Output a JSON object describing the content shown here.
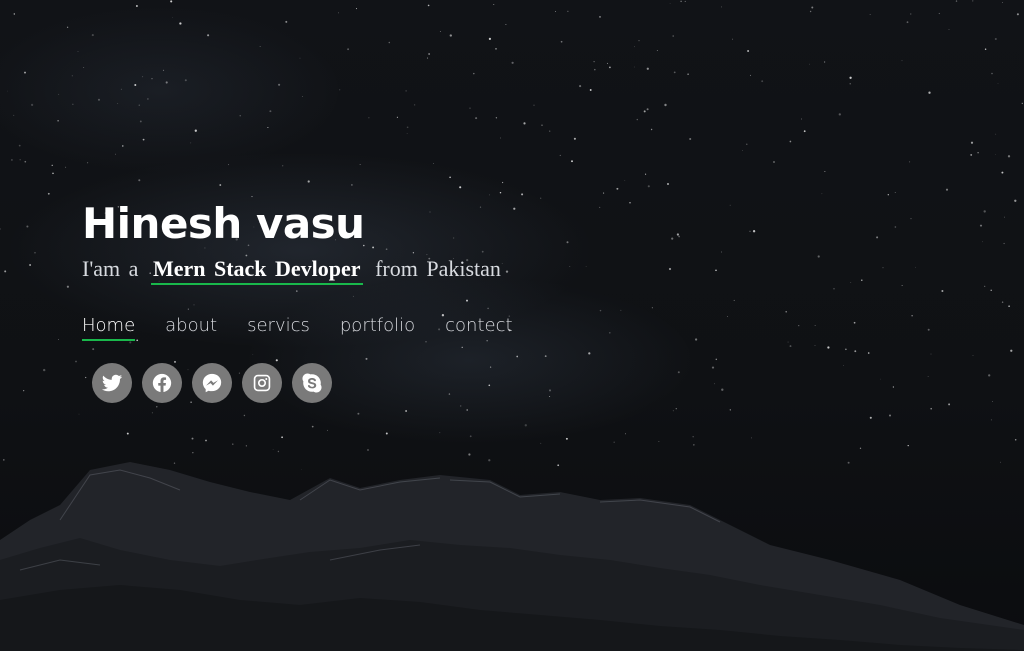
{
  "hero": {
    "name": "Hinesh vasu",
    "tagline_prefix": "I'am a",
    "role": "Mern Stack Devloper",
    "tagline_suffix": "from Pakistan"
  },
  "nav": {
    "items": [
      {
        "label": "Home",
        "active": true
      },
      {
        "label": "about"
      },
      {
        "label": "servics"
      },
      {
        "label": "portfolio"
      },
      {
        "label": "contect"
      }
    ]
  },
  "social": {
    "icons": [
      "twitter-icon",
      "facebook-icon",
      "messenger-icon",
      "instagram-icon",
      "skype-icon"
    ]
  },
  "colors": {
    "accent": "#19b84b",
    "icon_bg": "#7a7a7a",
    "background": "#101114"
  }
}
